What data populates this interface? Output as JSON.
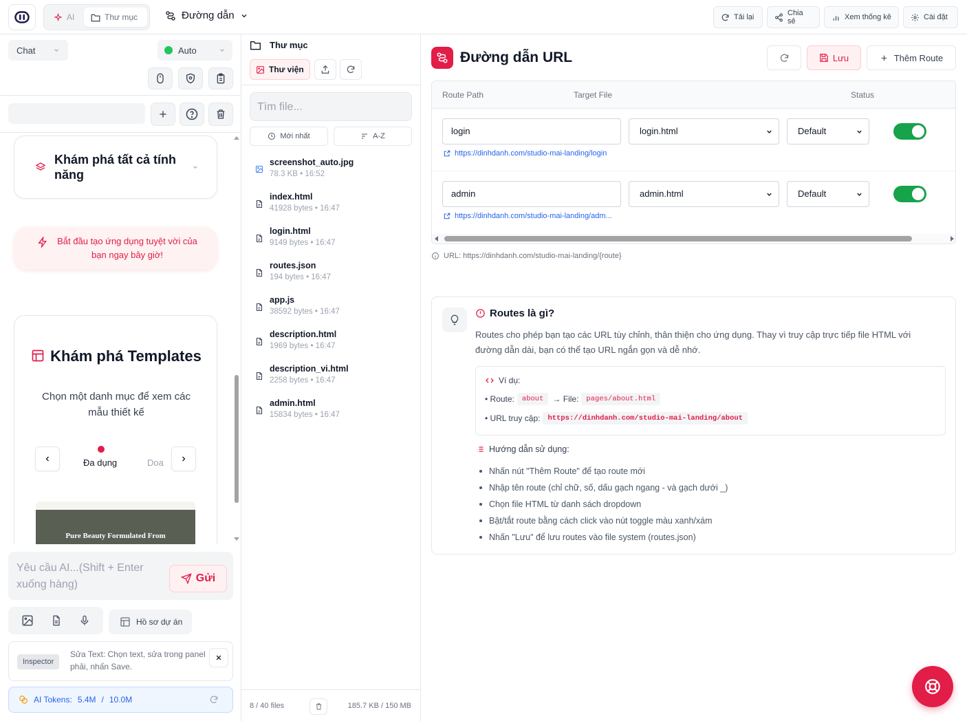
{
  "topbar": {
    "mode_ai": "AI",
    "mode_folder": "Thư mục",
    "path_selector": "Đường dẫn",
    "reload": "Tải lại",
    "share": "Chia sẻ",
    "stats": "Xem thống kê",
    "settings": "Cài đặt"
  },
  "left": {
    "chat_select": "Chat",
    "model_select": "Auto",
    "feature_card": "Khám phá tất cả tính năng",
    "cta": "Bắt đầu tạo ứng dụng tuyệt vời của bạn ngay bây giờ!",
    "templates": {
      "title": "Khám phá Templates",
      "subtitle": "Chọn một danh mục để xem các mẫu thiết kế",
      "category_active": "Đa dụng",
      "category_next": "Doa",
      "thumb_text": "Pure Beauty Formulated From"
    },
    "composer": {
      "placeholder": "Yêu cầu AI...(Shift + Enter xuống hàng)",
      "send": "Gửi"
    },
    "project_profile": "Hồ sơ dự án",
    "inspector": {
      "tag": "Inspector",
      "text": "Sửa Text: Chọn text, sửa trong panel phải, nhấn Save."
    },
    "tokens": {
      "label": "AI Tokens:",
      "used": "5.4M",
      "sep": "/",
      "total": "10.0M"
    }
  },
  "files": {
    "header": "Thư mục",
    "library": "Thư viện",
    "search_placeholder": "Tìm file...",
    "sort_newest": "Mới nhất",
    "sort_az": "A-Z",
    "items": [
      {
        "name": "screenshot_auto.jpg",
        "meta": "78.3 KB • 16:52"
      },
      {
        "name": "index.html",
        "meta": "41928 bytes • 16:47"
      },
      {
        "name": "login.html",
        "meta": "9149 bytes • 16:47"
      },
      {
        "name": "routes.json",
        "meta": "194 bytes • 16:47"
      },
      {
        "name": "app.js",
        "meta": "38592 bytes • 16:47"
      },
      {
        "name": "description.html",
        "meta": "1969 bytes • 16:47"
      },
      {
        "name": "description_vi.html",
        "meta": "2258 bytes • 16:47"
      },
      {
        "name": "admin.html",
        "meta": "15834 bytes • 16:47"
      }
    ],
    "footer_count": "8 / 40 files",
    "footer_size": "185.7 KB / 150 MB"
  },
  "main": {
    "title": "Đường dẫn URL",
    "save": "Lưu",
    "add_route": "Thêm Route",
    "columns": {
      "path": "Route Path",
      "target": "Target File",
      "status": "Status"
    },
    "routes": [
      {
        "path": "login",
        "target": "login.html",
        "mode": "Default",
        "enabled": true,
        "url": "https://dinhdanh.com/studio-mai-landing/login"
      },
      {
        "path": "admin",
        "target": "admin.html",
        "mode": "Default",
        "enabled": true,
        "url": "https://dinhdanh.com/studio-mai-landing/adm..."
      }
    ],
    "url_note": "URL: https://dinhdanh.com/studio-mai-landing/{route}",
    "info": {
      "title": "Routes là gì?",
      "desc": "Routes cho phép bạn tạo các URL tùy chỉnh, thân thiện cho ứng dụng. Thay vì truy cập trực tiếp file HTML với đường dẫn dài, bạn có thể tạo URL ngắn gọn và dễ nhớ.",
      "example_head": "Ví dụ:",
      "ex_route_label": "• Route:",
      "ex_route": "about",
      "ex_file_label": "→ File:",
      "ex_file": "pages/about.html",
      "ex_url_label": "• URL truy cập:",
      "ex_url": "https://dinhdanh.com/studio-mai-landing/about",
      "guide_head": "Hướng dẫn sử dụng:",
      "guide": [
        "Nhấn nút \"Thêm Route\" để tạo route mới",
        "Nhập tên route (chỉ chữ, số, dấu gạch ngang - và gạch dưới _)",
        "Chọn file HTML từ danh sách dropdown",
        "Bật/tắt route bằng cách click vào nút toggle màu xanh/xám",
        "Nhấn \"Lưu\" để lưu routes vào file system (routes.json)"
      ]
    }
  },
  "colors": {
    "accent": "#e11d48",
    "toggle_on": "#16a34a",
    "link": "#2563eb"
  }
}
